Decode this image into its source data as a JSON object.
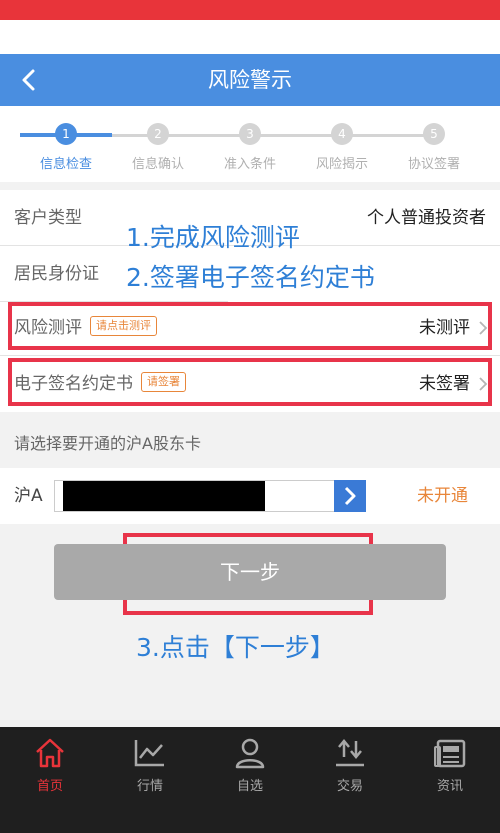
{
  "header": {
    "title": "风险警示",
    "back_icon": "chevron-left-icon"
  },
  "steps": [
    {
      "number": "1",
      "label": "信息检查",
      "active": true
    },
    {
      "number": "2",
      "label": "信息确认",
      "active": false
    },
    {
      "number": "3",
      "label": "准入条件",
      "active": false
    },
    {
      "number": "4",
      "label": "风险揭示",
      "active": false
    },
    {
      "number": "5",
      "label": "协议签署",
      "active": false
    }
  ],
  "info": {
    "customer_type": {
      "label": "客户类型",
      "value": "个人普通投资者"
    },
    "id_card": {
      "label": "居民身份证"
    },
    "risk_assessment": {
      "label": "风险测评",
      "tag": "请点击测评",
      "value": "未测评"
    },
    "e_signature": {
      "label": "电子签名约定书",
      "tag": "请签署",
      "value": "未签署"
    }
  },
  "annotations": {
    "line1": "1.完成风险测评",
    "line2": "2.签署电子签名约定书",
    "line3": "3.点击【下一步】"
  },
  "account": {
    "prompt": "请选择要开通的沪A股东卡",
    "label": "沪A",
    "status": "未开通"
  },
  "next_button": {
    "label": "下一步"
  },
  "tabs": [
    {
      "label": "首页",
      "icon": "home-icon",
      "active": true
    },
    {
      "label": "行情",
      "icon": "chart-icon",
      "active": false
    },
    {
      "label": "自选",
      "icon": "user-icon",
      "active": false
    },
    {
      "label": "交易",
      "icon": "trade-arrows-icon",
      "active": false
    },
    {
      "label": "资讯",
      "icon": "news-icon",
      "active": false
    }
  ],
  "colors": {
    "status_bar": "#e8343a",
    "primary": "#4a8ee0",
    "highlight": "#e8344a",
    "annotation": "#2e7fd6",
    "tag": "#e8863a",
    "button_disabled": "#a9a9a9",
    "tabbar": "#1f1f1f"
  }
}
